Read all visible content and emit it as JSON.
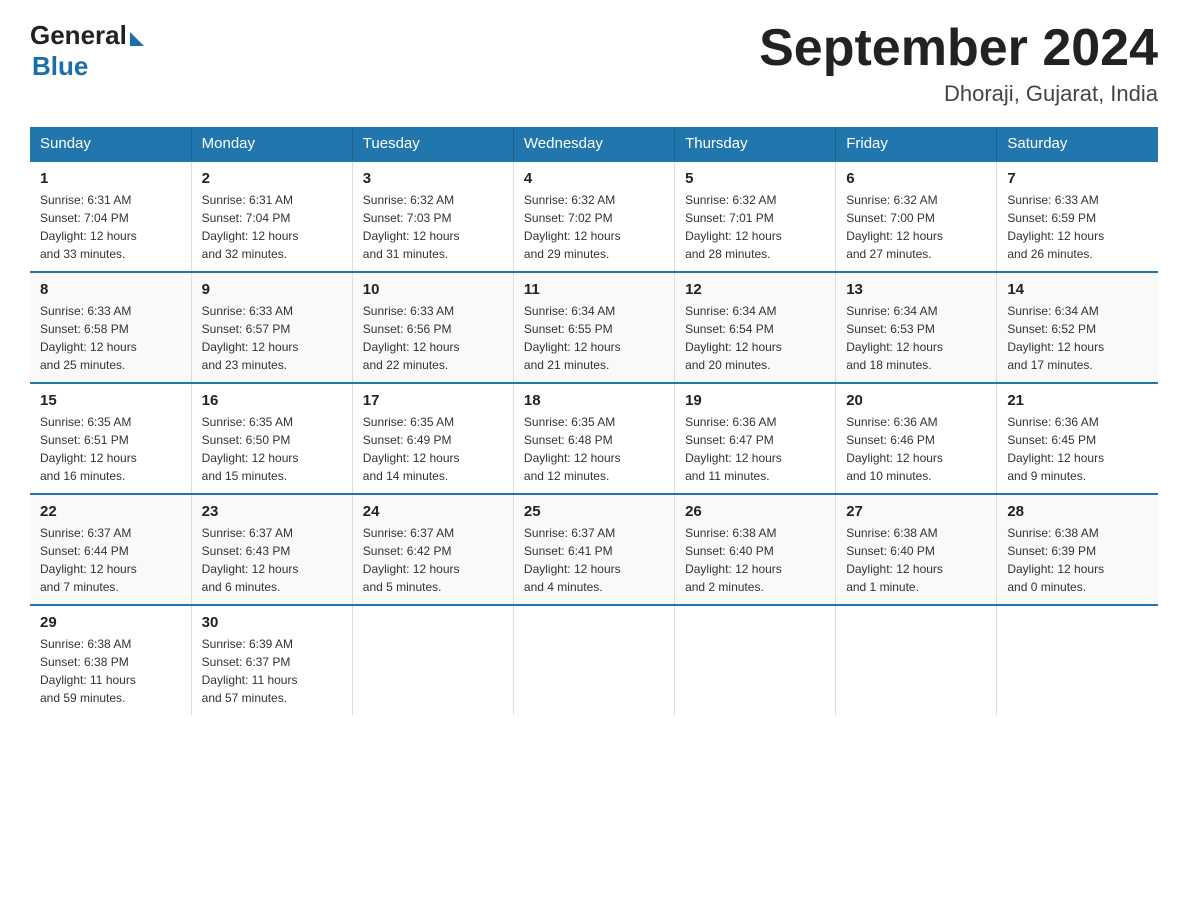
{
  "header": {
    "logo_general": "General",
    "logo_blue": "Blue",
    "month_year": "September 2024",
    "location": "Dhoraji, Gujarat, India"
  },
  "days_of_week": [
    "Sunday",
    "Monday",
    "Tuesday",
    "Wednesday",
    "Thursday",
    "Friday",
    "Saturday"
  ],
  "weeks": [
    [
      {
        "day": "1",
        "sunrise": "6:31 AM",
        "sunset": "7:04 PM",
        "daylight": "12 hours and 33 minutes."
      },
      {
        "day": "2",
        "sunrise": "6:31 AM",
        "sunset": "7:04 PM",
        "daylight": "12 hours and 32 minutes."
      },
      {
        "day": "3",
        "sunrise": "6:32 AM",
        "sunset": "7:03 PM",
        "daylight": "12 hours and 31 minutes."
      },
      {
        "day": "4",
        "sunrise": "6:32 AM",
        "sunset": "7:02 PM",
        "daylight": "12 hours and 29 minutes."
      },
      {
        "day": "5",
        "sunrise": "6:32 AM",
        "sunset": "7:01 PM",
        "daylight": "12 hours and 28 minutes."
      },
      {
        "day": "6",
        "sunrise": "6:32 AM",
        "sunset": "7:00 PM",
        "daylight": "12 hours and 27 minutes."
      },
      {
        "day": "7",
        "sunrise": "6:33 AM",
        "sunset": "6:59 PM",
        "daylight": "12 hours and 26 minutes."
      }
    ],
    [
      {
        "day": "8",
        "sunrise": "6:33 AM",
        "sunset": "6:58 PM",
        "daylight": "12 hours and 25 minutes."
      },
      {
        "day": "9",
        "sunrise": "6:33 AM",
        "sunset": "6:57 PM",
        "daylight": "12 hours and 23 minutes."
      },
      {
        "day": "10",
        "sunrise": "6:33 AM",
        "sunset": "6:56 PM",
        "daylight": "12 hours and 22 minutes."
      },
      {
        "day": "11",
        "sunrise": "6:34 AM",
        "sunset": "6:55 PM",
        "daylight": "12 hours and 21 minutes."
      },
      {
        "day": "12",
        "sunrise": "6:34 AM",
        "sunset": "6:54 PM",
        "daylight": "12 hours and 20 minutes."
      },
      {
        "day": "13",
        "sunrise": "6:34 AM",
        "sunset": "6:53 PM",
        "daylight": "12 hours and 18 minutes."
      },
      {
        "day": "14",
        "sunrise": "6:34 AM",
        "sunset": "6:52 PM",
        "daylight": "12 hours and 17 minutes."
      }
    ],
    [
      {
        "day": "15",
        "sunrise": "6:35 AM",
        "sunset": "6:51 PM",
        "daylight": "12 hours and 16 minutes."
      },
      {
        "day": "16",
        "sunrise": "6:35 AM",
        "sunset": "6:50 PM",
        "daylight": "12 hours and 15 minutes."
      },
      {
        "day": "17",
        "sunrise": "6:35 AM",
        "sunset": "6:49 PM",
        "daylight": "12 hours and 14 minutes."
      },
      {
        "day": "18",
        "sunrise": "6:35 AM",
        "sunset": "6:48 PM",
        "daylight": "12 hours and 12 minutes."
      },
      {
        "day": "19",
        "sunrise": "6:36 AM",
        "sunset": "6:47 PM",
        "daylight": "12 hours and 11 minutes."
      },
      {
        "day": "20",
        "sunrise": "6:36 AM",
        "sunset": "6:46 PM",
        "daylight": "12 hours and 10 minutes."
      },
      {
        "day": "21",
        "sunrise": "6:36 AM",
        "sunset": "6:45 PM",
        "daylight": "12 hours and 9 minutes."
      }
    ],
    [
      {
        "day": "22",
        "sunrise": "6:37 AM",
        "sunset": "6:44 PM",
        "daylight": "12 hours and 7 minutes."
      },
      {
        "day": "23",
        "sunrise": "6:37 AM",
        "sunset": "6:43 PM",
        "daylight": "12 hours and 6 minutes."
      },
      {
        "day": "24",
        "sunrise": "6:37 AM",
        "sunset": "6:42 PM",
        "daylight": "12 hours and 5 minutes."
      },
      {
        "day": "25",
        "sunrise": "6:37 AM",
        "sunset": "6:41 PM",
        "daylight": "12 hours and 4 minutes."
      },
      {
        "day": "26",
        "sunrise": "6:38 AM",
        "sunset": "6:40 PM",
        "daylight": "12 hours and 2 minutes."
      },
      {
        "day": "27",
        "sunrise": "6:38 AM",
        "sunset": "6:40 PM",
        "daylight": "12 hours and 1 minute."
      },
      {
        "day": "28",
        "sunrise": "6:38 AM",
        "sunset": "6:39 PM",
        "daylight": "12 hours and 0 minutes."
      }
    ],
    [
      {
        "day": "29",
        "sunrise": "6:38 AM",
        "sunset": "6:38 PM",
        "daylight": "11 hours and 59 minutes."
      },
      {
        "day": "30",
        "sunrise": "6:39 AM",
        "sunset": "6:37 PM",
        "daylight": "11 hours and 57 minutes."
      },
      null,
      null,
      null,
      null,
      null
    ]
  ],
  "labels": {
    "sunrise": "Sunrise:",
    "sunset": "Sunset:",
    "daylight": "Daylight:"
  }
}
